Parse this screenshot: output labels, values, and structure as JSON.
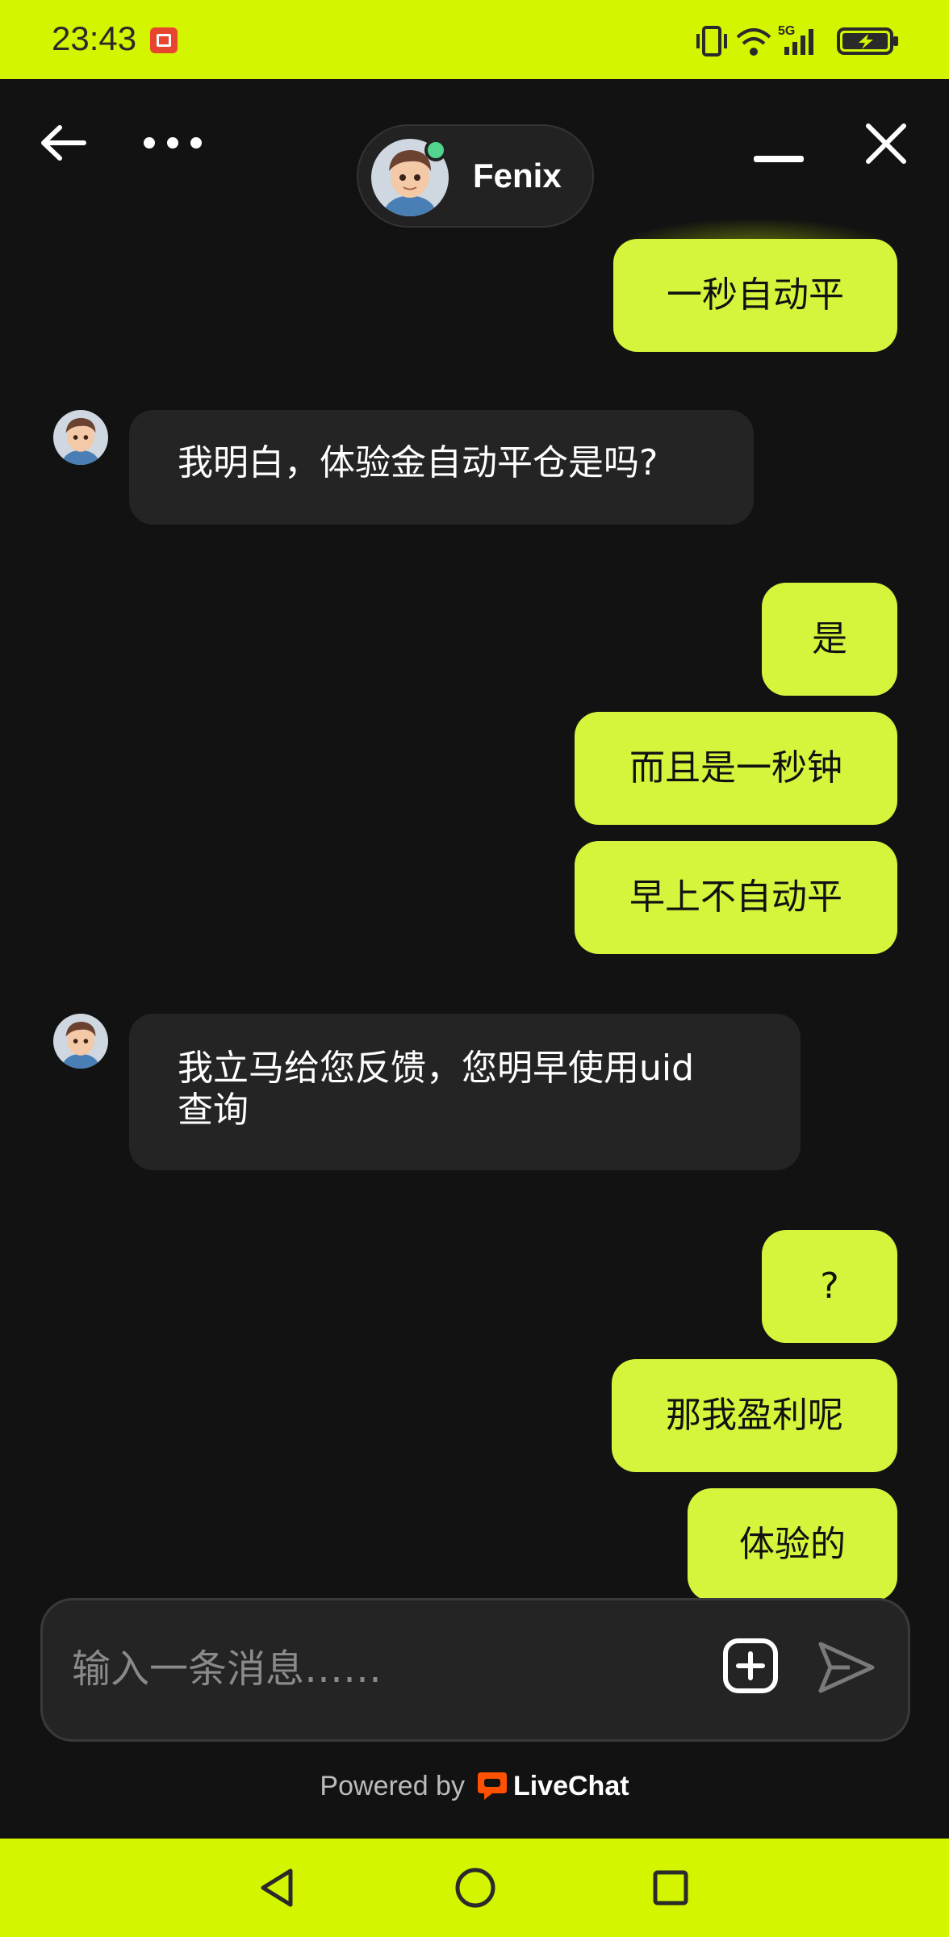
{
  "status_bar": {
    "time": "23:43",
    "network": "5G"
  },
  "header": {
    "agent_name": "Fenix",
    "back_icon": "arrow-left-icon",
    "more_icon": "more-horizontal-icon",
    "minimize_icon": "minimize-icon",
    "close_icon": "close-icon"
  },
  "messages": [
    {
      "side": "out",
      "text": "一秒自动平"
    },
    {
      "side": "in",
      "text": "我明白，体验金自动平仓是吗?"
    },
    {
      "side": "out",
      "text": "是"
    },
    {
      "side": "out",
      "text": "而且是一秒钟"
    },
    {
      "side": "out",
      "text": "早上不自动平"
    },
    {
      "side": "in",
      "text_line1": "我立马给您反馈，您明早使用uid",
      "text_line2": "查询"
    },
    {
      "side": "out",
      "text": "?"
    },
    {
      "side": "out",
      "text": "那我盈利呢"
    },
    {
      "side": "out",
      "text": "体验的"
    }
  ],
  "composer": {
    "placeholder": "输入一条消息……",
    "attach_icon": "plus-square-icon",
    "send_icon": "send-icon"
  },
  "footer": {
    "powered_by": "Powered by",
    "brand": "LiveChat"
  },
  "colors": {
    "accent": "#d4f500",
    "bubble_out": "#d4f53c",
    "bubble_in": "#242424",
    "background": "#121212",
    "online": "#52d48e"
  }
}
